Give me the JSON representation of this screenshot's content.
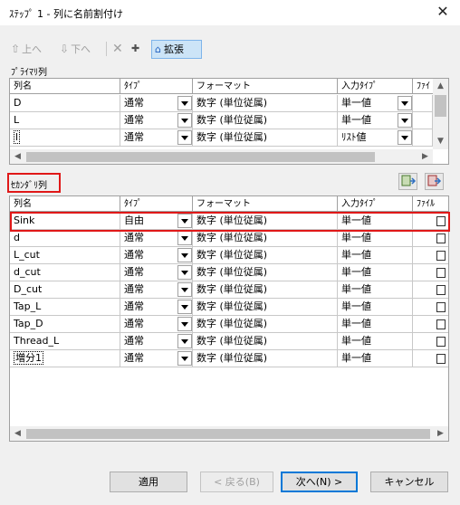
{
  "window": {
    "title": "ｽﾃｯﾌﾟ 1 - 列に名前割付け",
    "close_glyph": "✕"
  },
  "toolbar": {
    "up_label": "上へ",
    "up_icon": "⇧",
    "down_label": "下へ",
    "down_icon": "⇩",
    "delete_icon": "✕",
    "new_icon": "✚",
    "extend_label": "拡張",
    "extend_icon": "⌂"
  },
  "primary": {
    "label": "ﾌﾟﾗｲﾏﾘ列",
    "headers": [
      "列名",
      "ﾀｲﾌﾟ",
      "フォーマット",
      "入力ﾀｲﾌﾟ",
      "ﾌｧｲ"
    ],
    "rows": [
      {
        "name": "D",
        "type": "通常",
        "format": "数字 (単位従属)",
        "input": "単一値"
      },
      {
        "name": "L",
        "type": "通常",
        "format": "数字 (単位従属)",
        "input": "単一値"
      },
      {
        "name": "l",
        "type": "通常",
        "format": "数字 (単位従属)",
        "input": "ﾘｽﾄ値"
      }
    ]
  },
  "secondary": {
    "label": "ｾｶﾝﾀﾞﾘ列",
    "headers": [
      "列名",
      "ﾀｲﾌﾟ",
      "フォーマット",
      "入力ﾀｲﾌﾟ",
      "ﾌｧｲﾙ"
    ],
    "rows": [
      {
        "name": "Sink",
        "type": "自由",
        "format": "数字 (単位従属)",
        "input": "単一値"
      },
      {
        "name": "d",
        "type": "通常",
        "format": "数字 (単位従属)",
        "input": "単一値"
      },
      {
        "name": "L_cut",
        "type": "通常",
        "format": "数字 (単位従属)",
        "input": "単一値"
      },
      {
        "name": "d_cut",
        "type": "通常",
        "format": "数字 (単位従属)",
        "input": "単一値"
      },
      {
        "name": "D_cut",
        "type": "通常",
        "format": "数字 (単位従属)",
        "input": "単一値"
      },
      {
        "name": "Tap_L",
        "type": "通常",
        "format": "数字 (単位従属)",
        "input": "単一値"
      },
      {
        "name": "Tap_D",
        "type": "通常",
        "format": "数字 (単位従属)",
        "input": "単一値"
      },
      {
        "name": "Thread_L",
        "type": "通常",
        "format": "数字 (単位従属)",
        "input": "単一値"
      },
      {
        "name": "増分1",
        "type": "通常",
        "format": "数字 (単位従属)",
        "input": "単一値"
      }
    ]
  },
  "scroll": {
    "up": "▲",
    "down": "▼",
    "left": "◀",
    "right": "▶"
  },
  "buttons": {
    "apply": "適用",
    "back": "< 戻る(B)",
    "next": "次へ(N) >",
    "cancel": "キャンセル"
  },
  "colors": {
    "highlight": "#e01818",
    "accent": "#0078d7",
    "extend_bg": "#cce4f7"
  }
}
